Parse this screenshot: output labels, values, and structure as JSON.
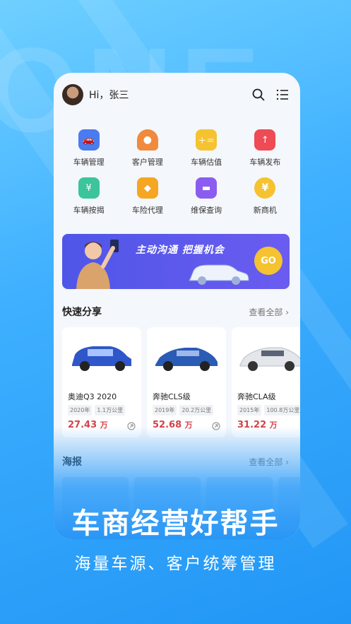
{
  "header": {
    "greeting": "Hi，张三"
  },
  "grid": [
    {
      "label": "车辆管理",
      "icon": "car-manage-icon",
      "color": "#4a7bf0"
    },
    {
      "label": "客户管理",
      "icon": "customer-icon",
      "color": "#f08a3c"
    },
    {
      "label": "车辆估值",
      "icon": "calculator-icon",
      "color": "#f5c330"
    },
    {
      "label": "车辆发布",
      "icon": "car-publish-icon",
      "color": "#ee4b55"
    },
    {
      "label": "车辆按揭",
      "icon": "car-mortgage-icon",
      "color": "#3cc49a"
    },
    {
      "label": "车险代理",
      "icon": "insurance-icon",
      "color": "#f5a623"
    },
    {
      "label": "维保查询",
      "icon": "toolbox-icon",
      "color": "#8b5cf0"
    },
    {
      "label": "新商机",
      "icon": "yen-coin-icon",
      "color": "#f5c330"
    }
  ],
  "banner": {
    "text": "主动沟通 把握机会",
    "go": "GO"
  },
  "quick_share": {
    "title": "快速分享",
    "more": "查看全部",
    "cards": [
      {
        "name": "奥迪Q3 2020",
        "year": "2020年",
        "km": "1.1万公里",
        "price": "27.43",
        "unit": "万",
        "color": "#2f57c9"
      },
      {
        "name": "奔驰CLS级",
        "year": "2019年",
        "km": "20.2万公里",
        "price": "52.68",
        "unit": "万",
        "color": "#2a5bb5"
      },
      {
        "name": "奔驰CLA级",
        "year": "2015年",
        "km": "100.8万公里",
        "price": "31.22",
        "unit": "万",
        "color": "#e8eaee"
      }
    ]
  },
  "poster": {
    "title": "海报",
    "more": "查看全部"
  },
  "headline": "车商经营好帮手",
  "subline": "海量车源、客户统筹管理"
}
